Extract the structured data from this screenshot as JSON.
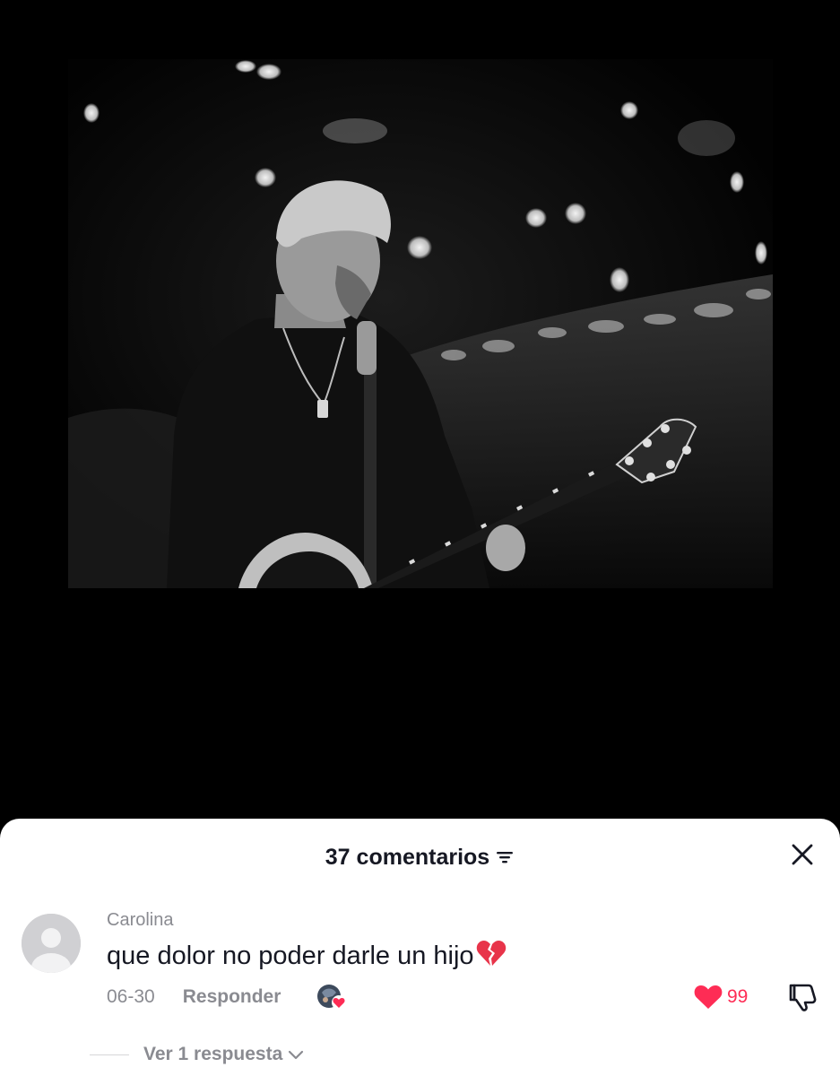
{
  "video": {
    "description_icon": "concert-guitarist-photo"
  },
  "comments_sheet": {
    "count_label": "37 comentarios",
    "sort_icon": "sort-lines-icon",
    "close_icon": "close-icon"
  },
  "comment": {
    "username": "Carolina",
    "text": "que dolor no poder darle un hijo",
    "emoji_icon": "broken-heart-icon",
    "date": "06-30",
    "reply_label": "Responder",
    "like_count": "99",
    "view_replies_label": "Ver 1 respuesta"
  },
  "colors": {
    "like_red": "#fe2c55",
    "secondary_text": "#8a8b91",
    "primary_text": "#161823"
  }
}
